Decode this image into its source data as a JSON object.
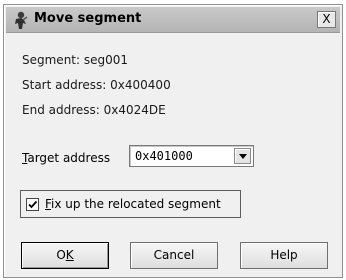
{
  "dialog": {
    "title": "Move segment",
    "close_glyph": "X",
    "icon": "app-person-icon"
  },
  "info": {
    "segment_label": "Segment:",
    "segment_value": "seg001",
    "start_label": "Start address:",
    "start_value": "0x400400",
    "end_label": "End address:",
    "end_value": "0x4024DE"
  },
  "target": {
    "label_accel": "T",
    "label_rest": "arget address",
    "value": "0x401000"
  },
  "fixup": {
    "checked": true,
    "label_accel": "F",
    "label_rest": "ix up the relocated segment"
  },
  "buttons": {
    "ok_main": "O",
    "ok_accel": "K",
    "cancel": "Cancel",
    "help": "Help"
  }
}
